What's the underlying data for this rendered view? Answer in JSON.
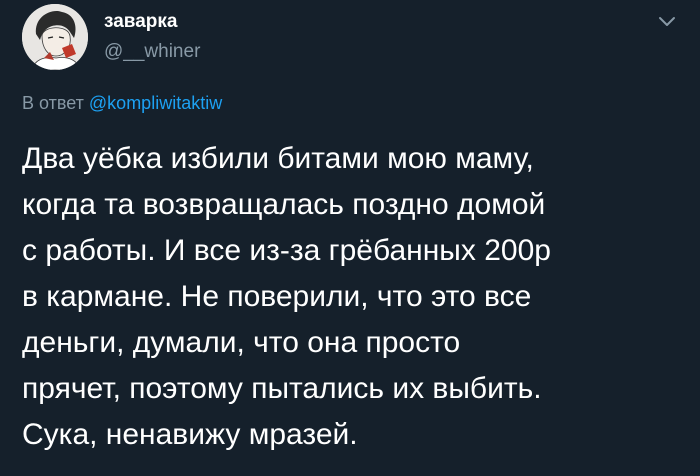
{
  "user": {
    "display_name": "заварка",
    "handle": "@__whiner",
    "avatar": "avatar-illustration"
  },
  "reply": {
    "prefix": "В ответ",
    "mention": "@kompliwitaktiw"
  },
  "tweet": {
    "lines": [
      "Два уёбка избили битами мою маму,",
      "когда та возвращалась поздно домой",
      "с работы. И все из-за грёбанных 200р",
      "в кармане. Не поверили, что это все",
      "деньги, думали, что она просто",
      "прячет, поэтому пытались их выбить.",
      "Сука, ненавижу мразей."
    ]
  },
  "icons": {
    "menu": "chevron-down-icon"
  },
  "colors": {
    "background": "#15202b",
    "secondary_text": "#8899a6",
    "link": "#1da1f2",
    "primary_text": "#ffffff"
  }
}
